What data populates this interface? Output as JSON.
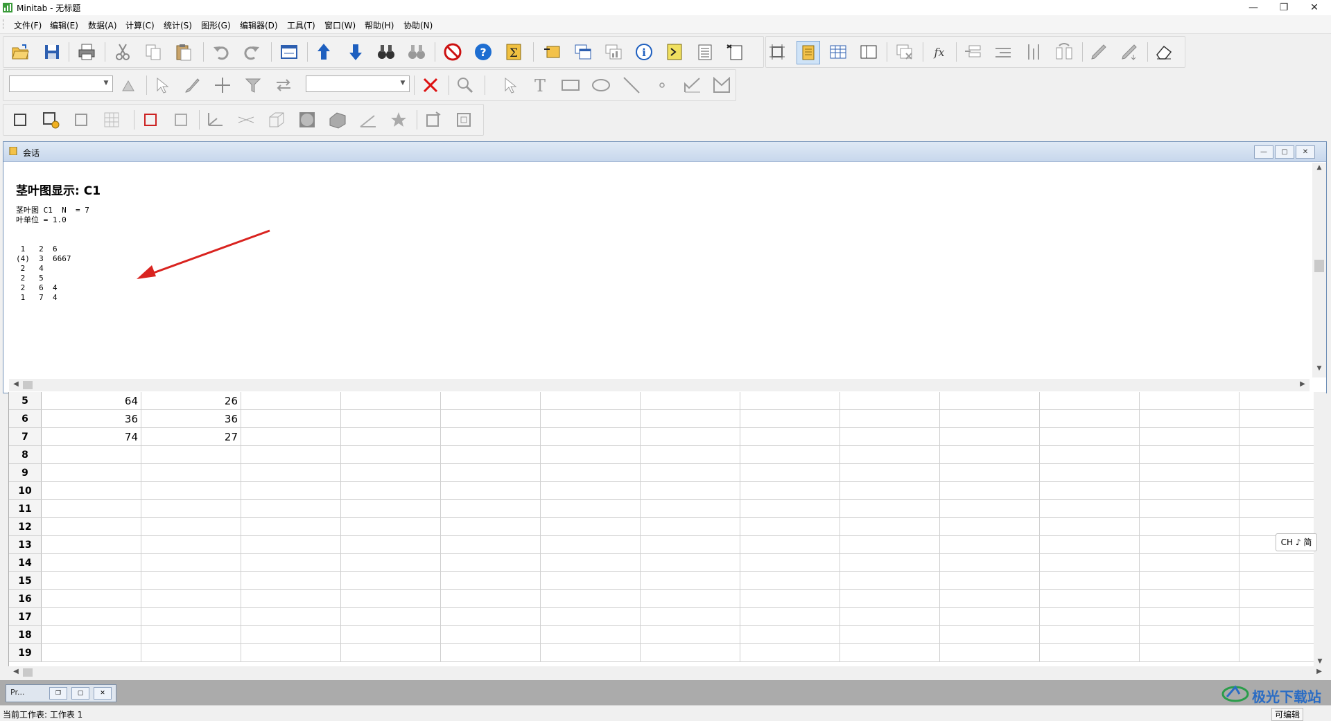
{
  "window": {
    "title": "Minitab - 无标题"
  },
  "menu": [
    "文件(F)",
    "编辑(E)",
    "数据(A)",
    "计算(C)",
    "统计(S)",
    "图形(G)",
    "编辑器(D)",
    "工具(T)",
    "窗口(W)",
    "帮助(H)",
    "协助(N)"
  ],
  "session": {
    "title": "会话",
    "heading": "茎叶图显示: C1",
    "output": "茎叶图 C1  N  = 7\n叶单位 = 1.0\n\n\n 1   2  6\n(4)  3  6667\n 2   4\n 2   5\n 2   6  4\n 1   7  4"
  },
  "worksheet": {
    "rows": [
      {
        "num": "5",
        "c1": "64",
        "c2": "26"
      },
      {
        "num": "6",
        "c1": "36",
        "c2": "36"
      },
      {
        "num": "7",
        "c1": "74",
        "c2": "27"
      },
      {
        "num": "8",
        "c1": "",
        "c2": ""
      },
      {
        "num": "9",
        "c1": "",
        "c2": ""
      },
      {
        "num": "10",
        "c1": "",
        "c2": ""
      },
      {
        "num": "11",
        "c1": "",
        "c2": ""
      },
      {
        "num": "12",
        "c1": "",
        "c2": ""
      },
      {
        "num": "13",
        "c1": "",
        "c2": ""
      },
      {
        "num": "14",
        "c1": "",
        "c2": ""
      },
      {
        "num": "15",
        "c1": "",
        "c2": ""
      },
      {
        "num": "16",
        "c1": "",
        "c2": ""
      },
      {
        "num": "17",
        "c1": "",
        "c2": ""
      },
      {
        "num": "18",
        "c1": "",
        "c2": ""
      },
      {
        "num": "19",
        "c1": "",
        "c2": ""
      }
    ]
  },
  "minimized_window": {
    "label": "Pr..."
  },
  "ime": {
    "label": "CH ♪ 简"
  },
  "status": {
    "left": "当前工作表: 工作表 1",
    "right": "可编辑"
  },
  "watermark": {
    "text": "极光下载站"
  },
  "colors": {
    "accent_blue": "#1e5fbf",
    "arrow_red": "#d9231f",
    "title_gradient": "#c7d7ec"
  }
}
